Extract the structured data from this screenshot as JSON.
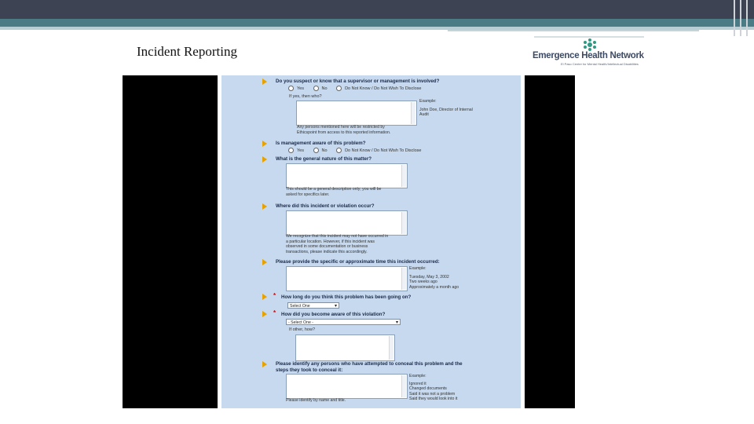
{
  "slide": {
    "title": "Incident Reporting"
  },
  "logo": {
    "text": "Emergence Health Network",
    "subtitle": "El Paso Center for Mental Health/Intellectual Disabilities",
    "mark": "logo-mark-icon"
  },
  "colors": {
    "form_bg": "#c6d9ee",
    "arrow": "#e8a200",
    "required": "#d00000",
    "header_dark": "#3d4353",
    "header_teal": "#4b7c86"
  },
  "form": {
    "q1": {
      "text": "Do you suspect or know that a supervisor or management is involved?",
      "opt_yes": "Yes",
      "opt_no": "No",
      "opt_dk": "Do Not Know / Do Not Wish To Disclose",
      "followup": "If yes, then who?",
      "example_title": "Example:",
      "example_1": "John Doe, Director of Internal",
      "example_2": "Audit",
      "note_1": "Any persons mentioned here will be restricted by",
      "note_2": "Ethicspoint from access to this reported information."
    },
    "q2": {
      "text": "Is management aware of this problem?",
      "opt_yes": "Yes",
      "opt_no": "No",
      "opt_dk": "Do Not Know / Do Not Wish To Disclose"
    },
    "q3": {
      "text": "What is the general nature of this matter?",
      "note_1": "This should be a general description only; you will be",
      "note_2": "asked for specifics later."
    },
    "q4": {
      "text": "Where did this incident or violation occur?",
      "note_1": "We recognize that this incident may not have occurred in",
      "note_2": "a particular location. However, if this incident was",
      "note_3": "observed in some documentation or business",
      "note_4": "transactions, please indicate this accordingly."
    },
    "q5": {
      "text": "Please provide the specific or approximate time this incident occurred:",
      "example_title": "Example:",
      "example_1": "Tuesday, May 3, 2002",
      "example_2": "Two weeks ago",
      "example_3": "Approximately a month ago"
    },
    "q6": {
      "text": "How long do you think this problem has been going on?",
      "select": "Select One"
    },
    "q7": {
      "text": "How did you become aware of this violation?",
      "select": "- Select One -",
      "followup": "If other, how?"
    },
    "q8": {
      "text_1": "Please identify any persons who have attempted to conceal this problem and the",
      "text_2": "steps they took to conceal it:",
      "example_title": "Example:",
      "example_1": "Ignored it",
      "example_2": "Changed documents",
      "example_3": "Said it was not a problem",
      "example_4": "Said they would look into it",
      "note": "Please identify by name and title."
    }
  }
}
